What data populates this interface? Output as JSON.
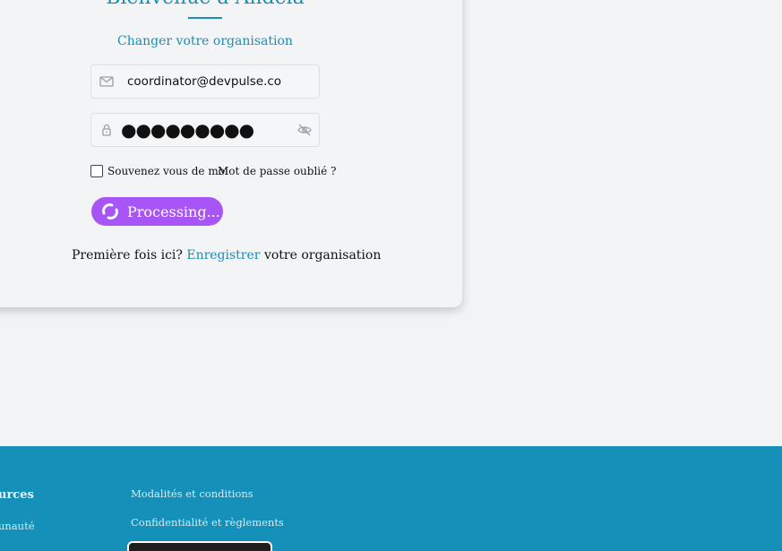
{
  "login": {
    "title": "Bienvenue à Andela",
    "change_org_link": "Changer votre organisation",
    "email_value": "coordinator@devpulse.co",
    "password_mask": "●●●●●●●●●",
    "remember_label": "Souvenez vous de moi",
    "remember_checked": false,
    "forgot_link": "Mot de passe oublié ?",
    "submit_label": "Processing...",
    "first_time_prefix": "Première fois ici?",
    "register_link": "Enregistrer",
    "first_time_suffix": "votre organisation"
  },
  "icons": {
    "email": "envelope-icon",
    "password": "lock-icon",
    "toggle_password": "eye-off-icon",
    "loading": "spinner-icon"
  },
  "colors": {
    "accent": "#1a8eb5",
    "button": "#a855f7",
    "footer": "#1590b8",
    "background": "#f2f3f5"
  },
  "footer": {
    "heading_partial": "urces",
    "left_link_partial": "unauté",
    "links": [
      "Modalités et conditions",
      "Confidentialité et règlements"
    ]
  }
}
